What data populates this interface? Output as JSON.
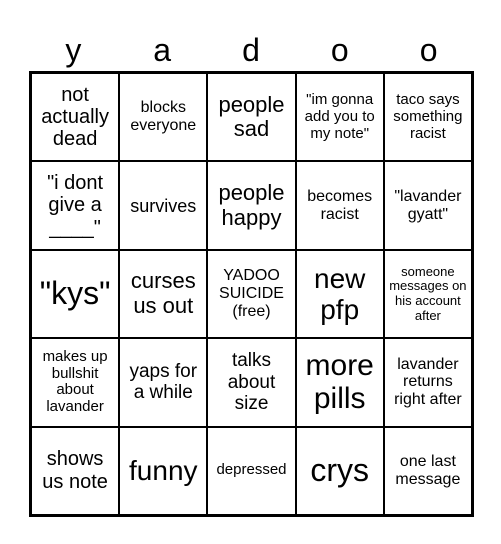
{
  "title_letters": [
    "y",
    "a",
    "d",
    "o",
    "o"
  ],
  "cells": [
    [
      "not actually dead",
      "blocks everyone",
      "people sad",
      "\"im gonna add you to my note\"",
      "taco says something racist"
    ],
    [
      "\"i dont give a ____\"",
      "survives",
      "people happy",
      "becomes racist",
      "\"lavander gyatt\""
    ],
    [
      "\"kys\"",
      "curses us out",
      "YADOO SUICIDE (free)",
      "new pfp",
      "someone messages on his account after"
    ],
    [
      "makes up bullshit about lavander",
      "yaps for a while",
      "talks about size",
      "more pills",
      "lavander returns right after"
    ],
    [
      "shows us note",
      "funny",
      "depressed",
      "crys",
      "one last message"
    ]
  ]
}
